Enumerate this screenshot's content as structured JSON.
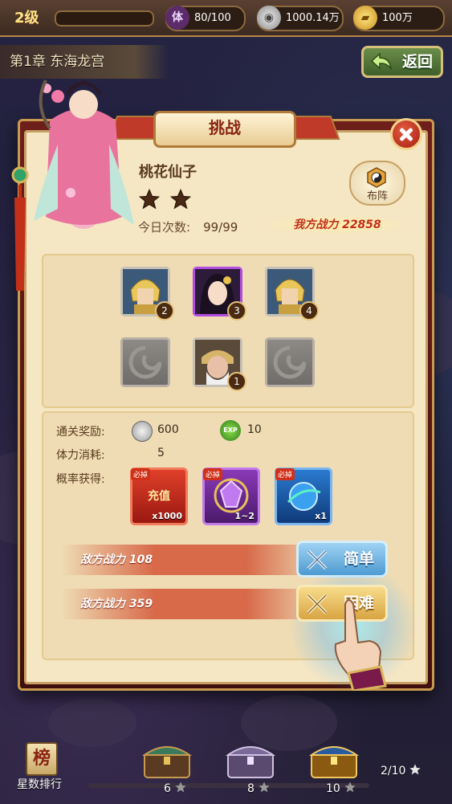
{
  "top_bar": {
    "level": "2级",
    "stamina_icon": "体",
    "stamina": "80/100",
    "silver": "1000.14万",
    "gold": "100万"
  },
  "chapter": {
    "title": "第1章 东海龙宫",
    "back_label": "返回"
  },
  "dialog": {
    "title": "挑战",
    "boss_name": "桃花仙子",
    "star_rating": 2,
    "daily_count_label": "今日次数:",
    "daily_count": "99/99",
    "formation_label": "布阵",
    "my_power": "我方战力 22858"
  },
  "enemies": [
    {
      "kind": "hero-gold-helmet",
      "badge": "2",
      "frame": "silver"
    },
    {
      "kind": "hero-lady",
      "badge": "3",
      "frame": "purple"
    },
    {
      "kind": "hero-gold-helmet",
      "badge": "4",
      "frame": "silver"
    },
    {
      "kind": "empty",
      "badge": "",
      "frame": "empty"
    },
    {
      "kind": "hero-elder",
      "badge": "1",
      "frame": "silver"
    },
    {
      "kind": "empty",
      "badge": "",
      "frame": "empty"
    }
  ],
  "rewards": {
    "clear_label": "通关奖励:",
    "silver": "600",
    "exp_icon": "EXP",
    "exp": "10",
    "stamina_label": "体力消耗:",
    "stamina_cost": "5",
    "drop_label": "概率获得:",
    "items": [
      {
        "name": "充值",
        "tag": "必掉",
        "qty": "x1000",
        "color": "#c4201c"
      },
      {
        "name": "",
        "tag": "必掉",
        "qty": "1~2",
        "color": "#7a2aa8"
      },
      {
        "name": "",
        "tag": "必掉",
        "qty": "x1",
        "color": "#1f5aa8"
      }
    ]
  },
  "difficulty": {
    "easy_power": "敌方战力 108",
    "easy_label": "简单",
    "hard_power": "敌方战力 359",
    "hard_label": "困难"
  },
  "bottom_bar": {
    "rank_icon_char": "榜",
    "rank_label": "星数排行",
    "chests": [
      "6",
      "8",
      "10"
    ],
    "stars_total": "2/10"
  },
  "colors": {
    "panel": "#f5e6c4",
    "frame": "#6e1f1a",
    "accent_red": "#c2301a"
  }
}
